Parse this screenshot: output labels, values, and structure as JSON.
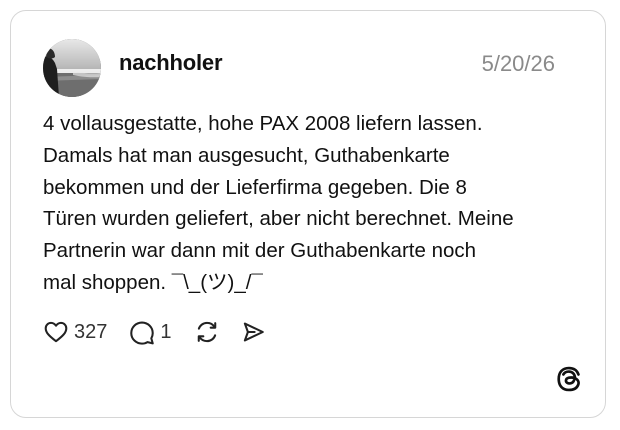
{
  "post": {
    "username": "nachholer",
    "date": "5/20/26",
    "text_lines": [
      "4 vollausgestatte, hohe PAX 2008 liefern lassen.",
      "Damals hat man ausgesucht, Guthabenkarte",
      "bekommen und der Lieferfirma gegeben. Die 8",
      "Türen wurden geliefert, aber nicht berechnet. Meine",
      "Partnerin war dann mit der Guthabenkarte noch",
      "mal shoppen. ¯\\_(ツ)_/¯"
    ],
    "likes": "327",
    "replies": "1"
  },
  "icons": {
    "like": "heart-icon",
    "reply": "speech-bubble-icon",
    "repost": "repost-arrows-icon",
    "share": "paper-plane-icon",
    "brand": "threads-logo-icon"
  },
  "colors": {
    "border": "#d6d6d6",
    "date": "#8a8a8a",
    "text": "#111111"
  }
}
